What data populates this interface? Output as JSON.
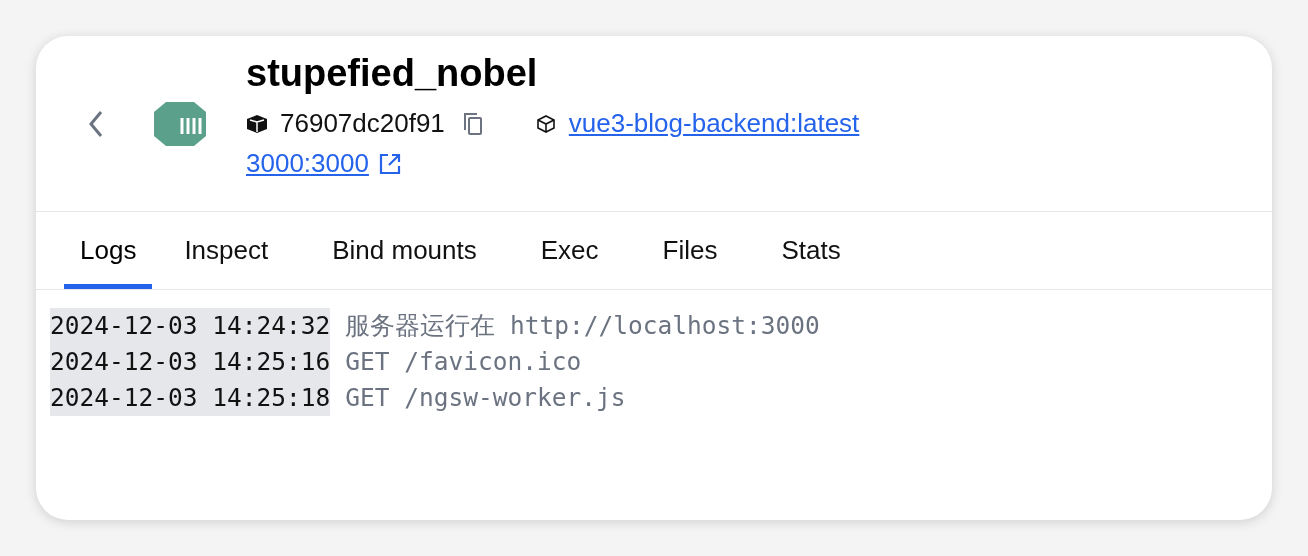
{
  "container": {
    "name": "stupefied_nobel",
    "id": "76907dc20f91",
    "image": "vue3-blog-backend:latest",
    "port": "3000:3000"
  },
  "tabs": [
    {
      "label": "Logs",
      "selected": true
    },
    {
      "label": "Inspect",
      "selected": false
    },
    {
      "label": "Bind mounts",
      "selected": false
    },
    {
      "label": "Exec",
      "selected": false
    },
    {
      "label": "Files",
      "selected": false
    },
    {
      "label": "Stats",
      "selected": false
    }
  ],
  "logs": [
    {
      "time": "2024-12-03 14:24:32",
      "message": "服务器运行在 http://localhost:3000"
    },
    {
      "time": "2024-12-03 14:25:16",
      "message": "GET /favicon.ico"
    },
    {
      "time": "2024-12-03 14:25:18",
      "message": "GET /ngsw-worker.js"
    }
  ]
}
